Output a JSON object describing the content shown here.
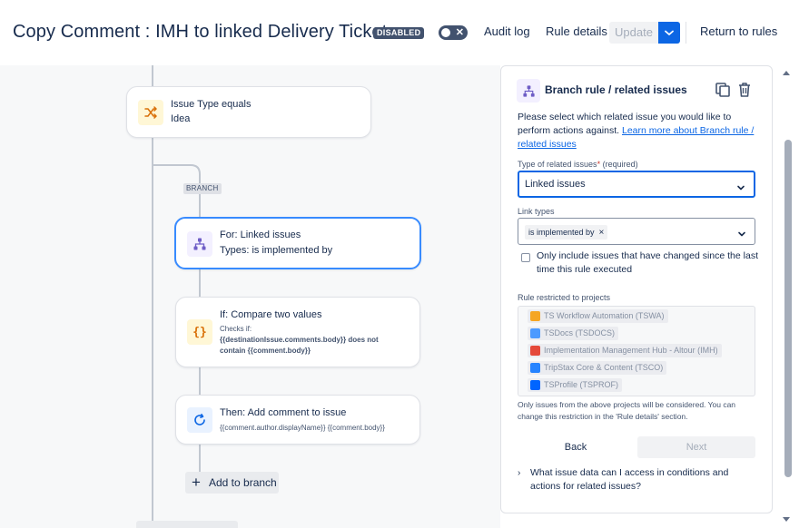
{
  "header": {
    "title": "Copy Comment : IMH to linked Delivery Tickets",
    "status_badge": "DISABLED",
    "toggle_off_glyph": "✕",
    "audit_log": "Audit log",
    "rule_details": "Rule details",
    "update": "Update",
    "return_to_rules": "Return to rules"
  },
  "canvas": {
    "trigger_card": {
      "line1": "Issue Type equals",
      "line2": "Idea",
      "icon": "shuffle-icon"
    },
    "branch_tag": "BRANCH",
    "branch_card": {
      "line1": "For: Linked issues",
      "line2": "Types: is implemented by",
      "icon": "hierarchy-icon"
    },
    "condition_card": {
      "line1": "If: Compare two values",
      "checks_label": "Checks if:",
      "checks_line1": "{{destinationIssue.comments.body}} does not",
      "checks_line2": "contain {{comment.body}}",
      "icon": "braces-icon"
    },
    "action_card": {
      "line1": "Then: Add comment to issue",
      "line2": "{{comment.author.displayName}} {{comment.body}}",
      "icon": "comment-loop-icon"
    },
    "add_to_branch": "Add to branch"
  },
  "panel": {
    "title": "Branch rule / related issues",
    "intro_text": "Please select which related issue you would like to perform actions against.",
    "intro_link": "Learn more about Branch rule / related issues",
    "type_label": "Type of related issues",
    "type_required_mark": "*",
    "type_required_text": "(required)",
    "type_value": "Linked issues",
    "link_types_label": "Link types",
    "link_type_tag": "is implemented by",
    "link_type_remove": "×",
    "checkbox_label": "Only include issues that have changed since the last time this rule executed",
    "restricted_label": "Rule restricted to projects",
    "projects": [
      {
        "name": "TS Workflow Automation (TSWA)",
        "color": "#f5a623"
      },
      {
        "name": "TSDocs (TSDOCS)",
        "color": "#4c9aff"
      },
      {
        "name": "Implementation Management Hub - Altour (IMH)",
        "color": "#e5493a"
      },
      {
        "name": "TripStax Core & Content (TSCO)",
        "color": "#2684ff"
      },
      {
        "name": "TSProfile (TSPROF)",
        "color": "#0065ff"
      }
    ],
    "note": "Only issues from the above projects will be considered. You can change this restriction in the 'Rule details' section.",
    "back": "Back",
    "next": "Next",
    "faq_caret": "›",
    "faq": "What issue data can I access in conditions and actions for related issues?"
  }
}
